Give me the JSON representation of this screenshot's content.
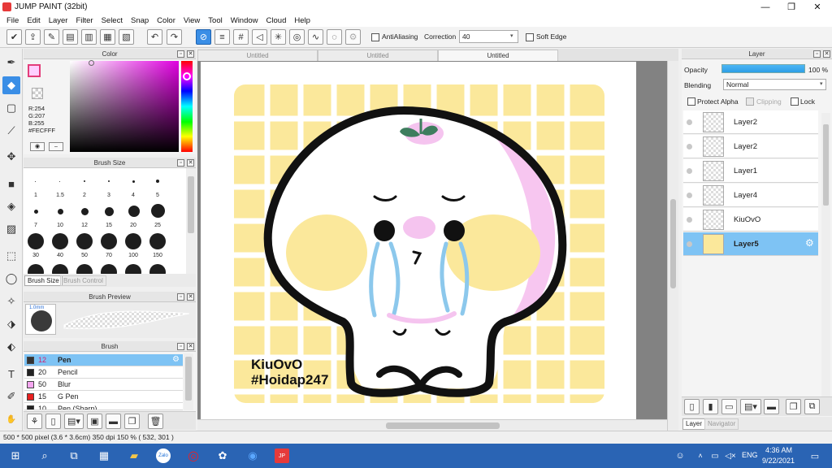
{
  "app_title": "JUMP PAINT (32bit)",
  "menu": [
    "File",
    "Edit",
    "Layer",
    "Filter",
    "Select",
    "Snap",
    "Color",
    "View",
    "Tool",
    "Window",
    "Cloud",
    "Help"
  ],
  "toolbar": {
    "antialiasing_label": "AntiAliasing",
    "correction_label": "Correction",
    "correction_value": "40",
    "soft_edge_label": "Soft Edge"
  },
  "color_panel": {
    "title": "Color",
    "r": "R:254",
    "g": "G:207",
    "b": "B:255",
    "hex": "#FECFFF",
    "accent": "#FECFFF"
  },
  "brush_size_panel": {
    "title": "Brush Size",
    "sizes": [
      "1",
      "1.5",
      "2",
      "3",
      "4",
      "5",
      "7",
      "10",
      "12",
      "15",
      "20",
      "25",
      "30",
      "40",
      "50",
      "70",
      "100",
      "150"
    ],
    "tabs": [
      "Brush Size",
      "Brush Control"
    ]
  },
  "brush_preview_panel": {
    "title": "Brush Preview",
    "size_label": "1.0mm"
  },
  "brush_panel": {
    "title": "Brush",
    "items": [
      {
        "size": "12",
        "name": "Pen",
        "color": "#333333"
      },
      {
        "size": "20",
        "name": "Pencil",
        "color": "#222222"
      },
      {
        "size": "50",
        "name": "Blur",
        "color": "#f5a6f0"
      },
      {
        "size": "15",
        "name": "G Pen",
        "color": "#e82020"
      },
      {
        "size": "10",
        "name": "Pen (Sharp)",
        "color": "#222222"
      }
    ]
  },
  "doc_tabs": [
    "Untitled",
    "Untitled",
    "Untitled"
  ],
  "canvas": {
    "watermark_line1": "KiuOvO",
    "watermark_line2": "#Hoidap247"
  },
  "layer_panel": {
    "title": "Layer",
    "opacity_label": "Opacity",
    "opacity_value": "100 %",
    "blending_label": "Blending",
    "blending_value": "Normal",
    "protect_alpha": "Protect Alpha",
    "clipping": "Clipping",
    "lock": "Lock",
    "layers": [
      "Layer2",
      "Layer2",
      "Layer1",
      "Layer4",
      "KiuOvO",
      "Layer5"
    ],
    "tabs": [
      "Layer",
      "Navigator"
    ]
  },
  "statusbar": {
    "text": "500 * 500 pixel  (3.6 * 3.6cm)  350 dpi  150 %  ( 532, 301 )"
  },
  "taskbar": {
    "lang": "ENG",
    "time": "4:36 AM",
    "date": "9/22/2021"
  }
}
